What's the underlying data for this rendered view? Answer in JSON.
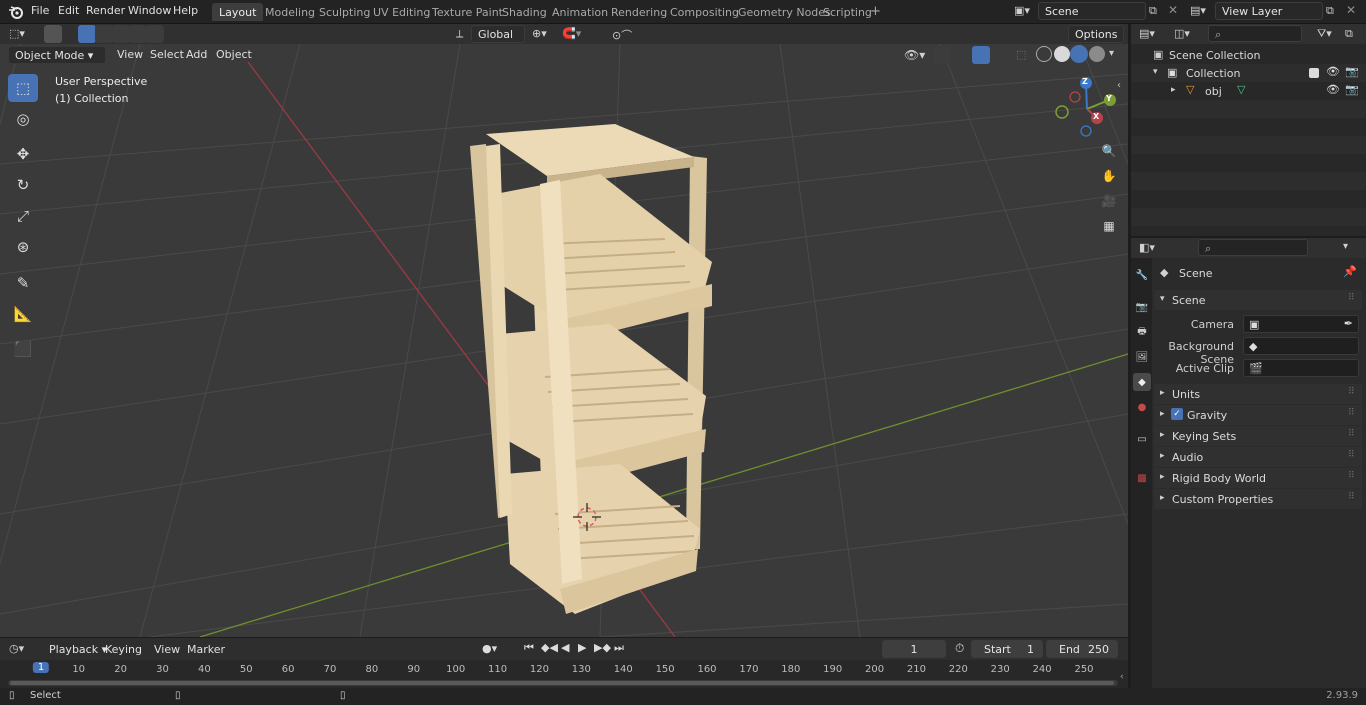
{
  "topbar": {
    "menus": [
      "File",
      "Edit",
      "Render",
      "Window",
      "Help"
    ],
    "workspaces": [
      "Layout",
      "Modeling",
      "Sculpting",
      "UV Editing",
      "Texture Paint",
      "Shading",
      "Animation",
      "Rendering",
      "Compositing",
      "Geometry Nodes",
      "Scripting"
    ],
    "active_workspace": "Layout",
    "scene_name": "Scene",
    "view_layer_name": "View Layer",
    "add_workspace_icon": "plus-icon"
  },
  "viewport_header": {
    "mode": "Object Mode",
    "menus": [
      "View",
      "Select",
      "Add",
      "Object"
    ],
    "orientation": "Global",
    "options_label": "Options"
  },
  "viewport": {
    "perspective_label": "User Perspective",
    "collection_label": "(1) Collection",
    "gizmo_axes": [
      "Z",
      "Y",
      "X"
    ],
    "colors": {
      "x_axis": "#b5434c",
      "y_axis": "#7d9e35",
      "z_axis": "#3b78c9",
      "wood": "#e9d7b1",
      "wood_shadow": "#c9b38a"
    }
  },
  "tools": [
    "select-box-icon",
    "cursor-icon",
    "move-icon",
    "rotate-icon",
    "scale-icon",
    "transform-icon",
    "annotate-icon",
    "measure-icon",
    "add-cube-icon"
  ],
  "outliner": {
    "items": [
      {
        "label": "Scene Collection",
        "icon": "scene-collection-icon"
      },
      {
        "label": "Collection",
        "icon": "collection-icon"
      },
      {
        "label": "obj",
        "icon": "mesh-object-icon"
      }
    ]
  },
  "properties": {
    "breadcrumb": "Scene",
    "panel_title": "Scene",
    "fields": [
      {
        "label": "Camera",
        "value": ""
      },
      {
        "label": "Background Scene",
        "value": ""
      },
      {
        "label": "Active Clip",
        "value": ""
      }
    ],
    "subpanels": [
      "Units",
      "Gravity",
      "Keying Sets",
      "Audio",
      "Rigid Body World",
      "Custom Properties"
    ],
    "gravity_checked": true
  },
  "timeline": {
    "menus": [
      "Playback",
      "Keying",
      "View",
      "Marker"
    ],
    "current_frame": "1",
    "start_label": "Start",
    "start_value": "1",
    "end_label": "End",
    "end_value": "250",
    "ticks": [
      "1",
      "10",
      "20",
      "30",
      "40",
      "50",
      "60",
      "70",
      "80",
      "90",
      "100",
      "110",
      "120",
      "130",
      "140",
      "150",
      "160",
      "170",
      "180",
      "190",
      "200",
      "210",
      "220",
      "230",
      "240",
      "250"
    ]
  },
  "status": {
    "left_label": "Select",
    "version": "2.93.9"
  }
}
